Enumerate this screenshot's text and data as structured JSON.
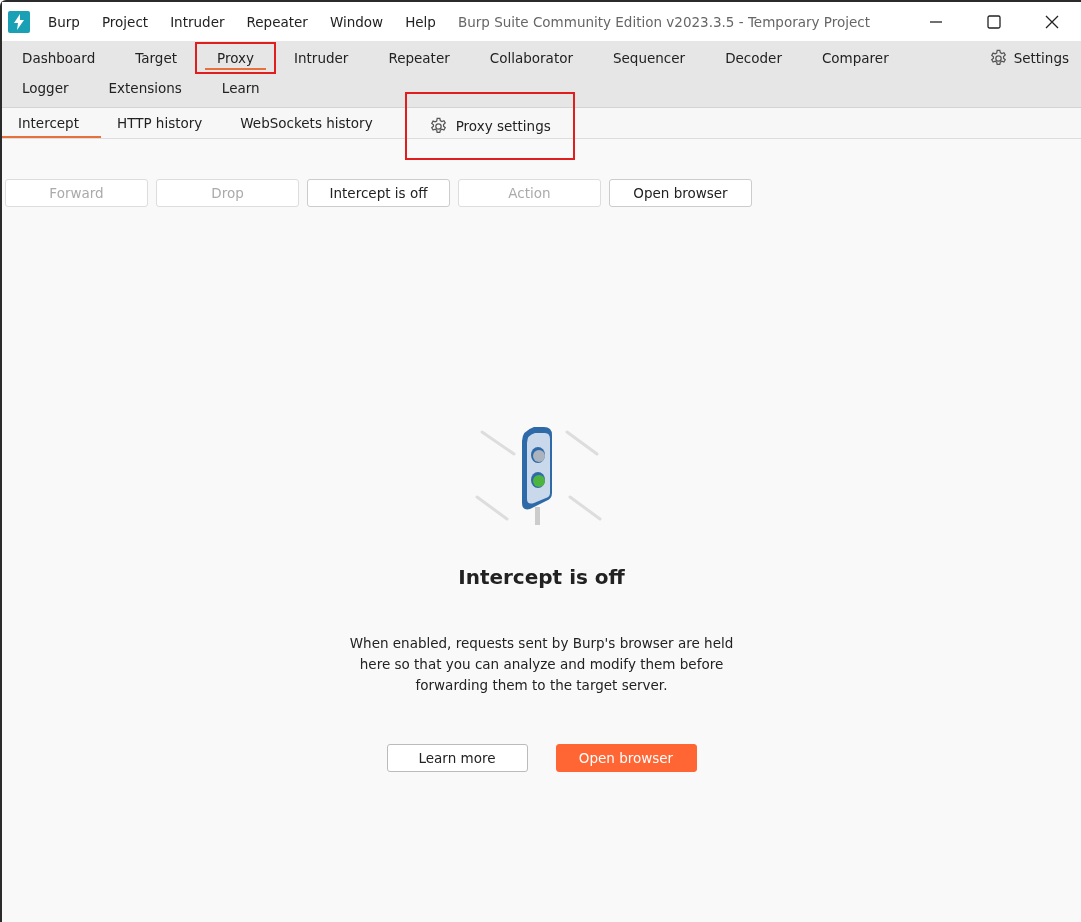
{
  "title_bar": {
    "menus": [
      "Burp",
      "Project",
      "Intruder",
      "Repeater",
      "Window",
      "Help"
    ],
    "title": "Burp Suite Community Edition v2023.3.5 - Temporary Project"
  },
  "main_tabs": {
    "rows": [
      [
        {
          "label": "Dashboard",
          "selected": false,
          "highlighted": false
        },
        {
          "label": "Target",
          "selected": false,
          "highlighted": false
        },
        {
          "label": "Proxy",
          "selected": true,
          "highlighted": true
        },
        {
          "label": "Intruder",
          "selected": false,
          "highlighted": false
        },
        {
          "label": "Repeater",
          "selected": false,
          "highlighted": false
        },
        {
          "label": "Collaborator",
          "selected": false,
          "highlighted": false
        },
        {
          "label": "Sequencer",
          "selected": false,
          "highlighted": false
        },
        {
          "label": "Decoder",
          "selected": false,
          "highlighted": false
        },
        {
          "label": "Comparer",
          "selected": false,
          "highlighted": false
        }
      ],
      [
        {
          "label": "Logger",
          "selected": false,
          "highlighted": false
        },
        {
          "label": "Extensions",
          "selected": false,
          "highlighted": false
        },
        {
          "label": "Learn",
          "selected": false,
          "highlighted": false
        }
      ]
    ],
    "settings": "Settings"
  },
  "sub_tabs": [
    {
      "label": "Intercept",
      "selected": true,
      "highlighted": false
    },
    {
      "label": "HTTP history",
      "selected": false,
      "highlighted": false
    },
    {
      "label": "WebSockets history",
      "selected": false,
      "highlighted": false
    }
  ],
  "proxy_settings": {
    "label": "Proxy settings",
    "highlighted": true
  },
  "toolbar": [
    {
      "label": "Forward",
      "disabled": true
    },
    {
      "label": "Drop",
      "disabled": true
    },
    {
      "label": "Intercept is off",
      "disabled": false
    },
    {
      "label": "Action",
      "disabled": true
    },
    {
      "label": "Open browser",
      "disabled": false
    }
  ],
  "empty_state": {
    "heading": "Intercept is off",
    "description": "When enabled, requests sent by Burp's browser are held here so that you can analyze and modify them before forwarding them to the target server.",
    "buttons": [
      {
        "label": "Learn more",
        "kind": "secondary"
      },
      {
        "label": "Open browser",
        "kind": "primary"
      }
    ]
  }
}
